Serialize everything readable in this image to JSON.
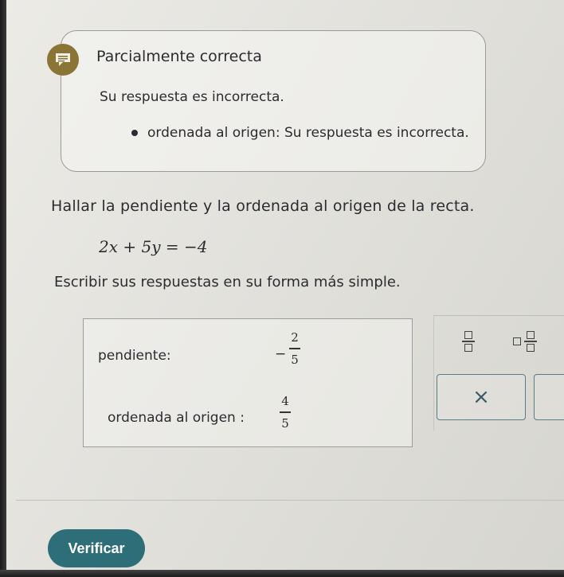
{
  "feedback": {
    "title": "Parcialmente correcta",
    "subtitle": "Su respuesta es incorrecta.",
    "bullet": "ordenada al origen: Su respuesta es incorrecta."
  },
  "problem": {
    "question": "Hallar la pendiente y la ordenada al origen de la recta.",
    "equation": "2x + 5y = −4",
    "instruction": "Escribir sus respuestas en su forma más simple."
  },
  "answers": {
    "slope_label": "pendiente:",
    "slope_sign": "−",
    "slope_num": "2",
    "slope_den": "5",
    "intercept_label": "ordenada al origen :",
    "intercept_num": "4",
    "intercept_den": "5"
  },
  "tools": {
    "fraction_icon": "fraction-icon",
    "mixed_number_icon": "mixed-number-icon",
    "clear_symbol": "×"
  },
  "verify_label": "Verificar",
  "colors": {
    "accent": "#2d6e78",
    "feedback_icon": "#8a7436"
  }
}
